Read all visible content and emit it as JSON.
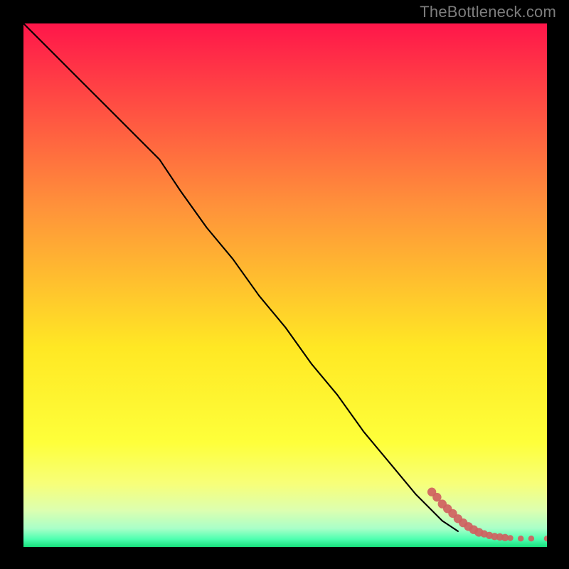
{
  "watermark": "TheBottleneck.com",
  "chart_data": {
    "type": "line",
    "title": "",
    "xlabel": "",
    "ylabel": "",
    "xlim": [
      0,
      100
    ],
    "ylim": [
      0,
      100
    ],
    "grid": false,
    "legend": "none",
    "background_gradient": {
      "top_color": "#ff164a",
      "mid_upper_color": "#ff923a",
      "mid_color": "#ffe824",
      "lower_color": "#f7ff7a",
      "bottom_color": "#18e07d"
    },
    "series": [
      {
        "name": "curve",
        "style": "black-line",
        "x": [
          0,
          5,
          10,
          16,
          22,
          26,
          30,
          35,
          40,
          45,
          50,
          55,
          60,
          65,
          70,
          75,
          80,
          83
        ],
        "y": [
          100,
          95,
          90,
          84,
          78,
          74,
          68,
          61,
          55,
          48,
          42,
          35,
          29,
          22,
          16,
          10,
          5,
          3
        ]
      },
      {
        "name": "tail-points",
        "style": "salmon-dots",
        "x": [
          78,
          79,
          80,
          81,
          82,
          83,
          84,
          85,
          86,
          87,
          88,
          89,
          90,
          91,
          92,
          93,
          95,
          97,
          100
        ],
        "y": [
          10.5,
          9.5,
          8.2,
          7.3,
          6.4,
          5.4,
          4.6,
          3.9,
          3.3,
          2.8,
          2.5,
          2.2,
          2.0,
          1.9,
          1.8,
          1.7,
          1.6,
          1.6,
          1.6
        ]
      }
    ]
  }
}
